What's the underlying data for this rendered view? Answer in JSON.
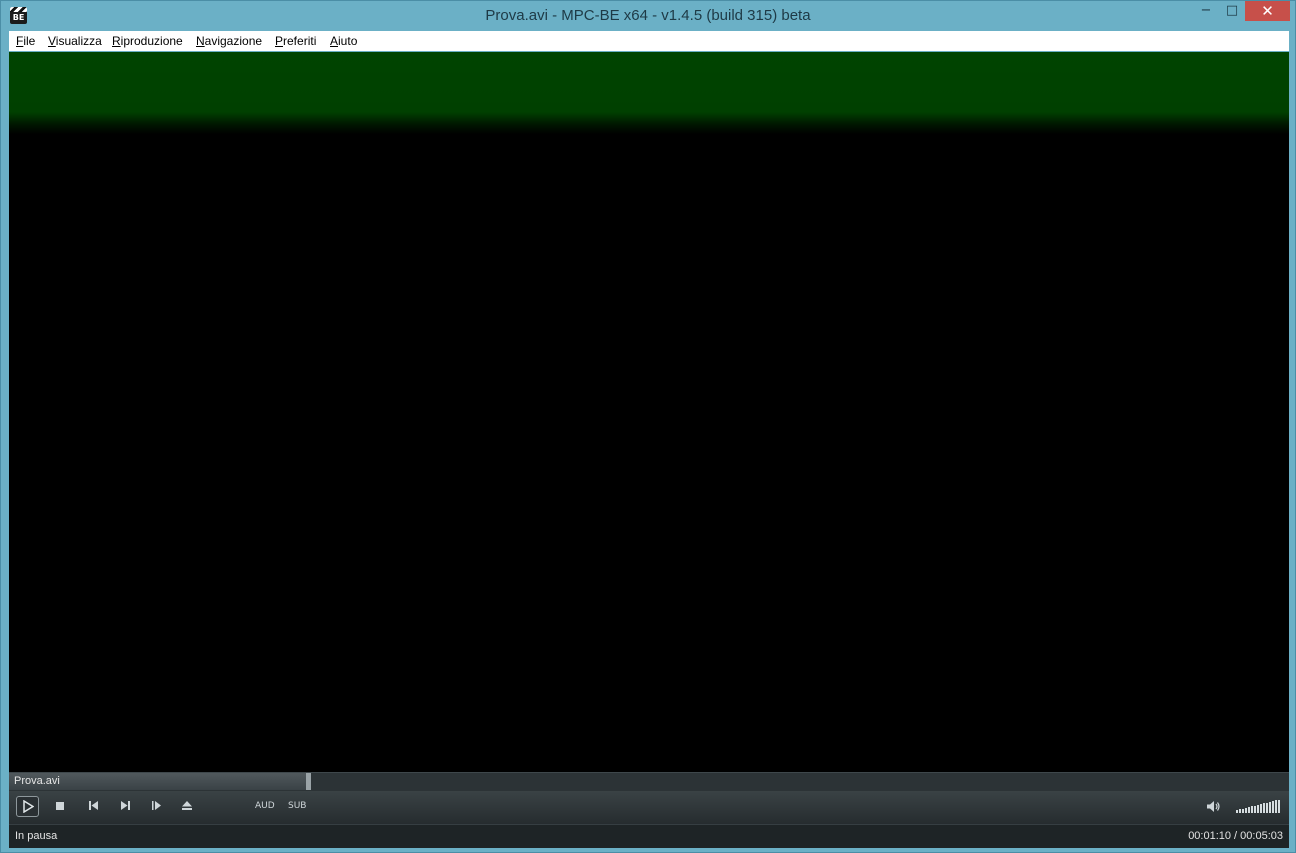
{
  "window": {
    "title": "Prova.avi - MPC-BE x64 - v1.4.5 (build 315) beta",
    "app_icon_text": "BE",
    "controls": {
      "minimize": "−",
      "maximize": "□",
      "close": "✕"
    }
  },
  "menu": [
    {
      "accel": "F",
      "rest": "ile"
    },
    {
      "accel": "V",
      "rest": "isualizza"
    },
    {
      "accel": "R",
      "rest": "iproduzione"
    },
    {
      "accel": "N",
      "rest": "avigazione"
    },
    {
      "accel": "P",
      "rest": "referiti"
    },
    {
      "accel": "A",
      "rest": "iuto"
    }
  ],
  "seek": {
    "file_label": "Prova.avi",
    "position_fraction": 0.2318
  },
  "toolbar": {
    "icons": [
      "play-icon",
      "stop-icon",
      "previous-icon",
      "next-icon",
      "frame-step-icon",
      "eject-icon",
      "speaker-icon"
    ],
    "aud_label": "AUD",
    "sub_label": "SUB",
    "volume_fraction": 1.0
  },
  "status": {
    "state": "In pausa",
    "time": "00:01:10 / 00:05:03"
  },
  "colors": {
    "video_band": "#004400",
    "frame": "#6bb0c6",
    "close_button": "#c7504a"
  }
}
